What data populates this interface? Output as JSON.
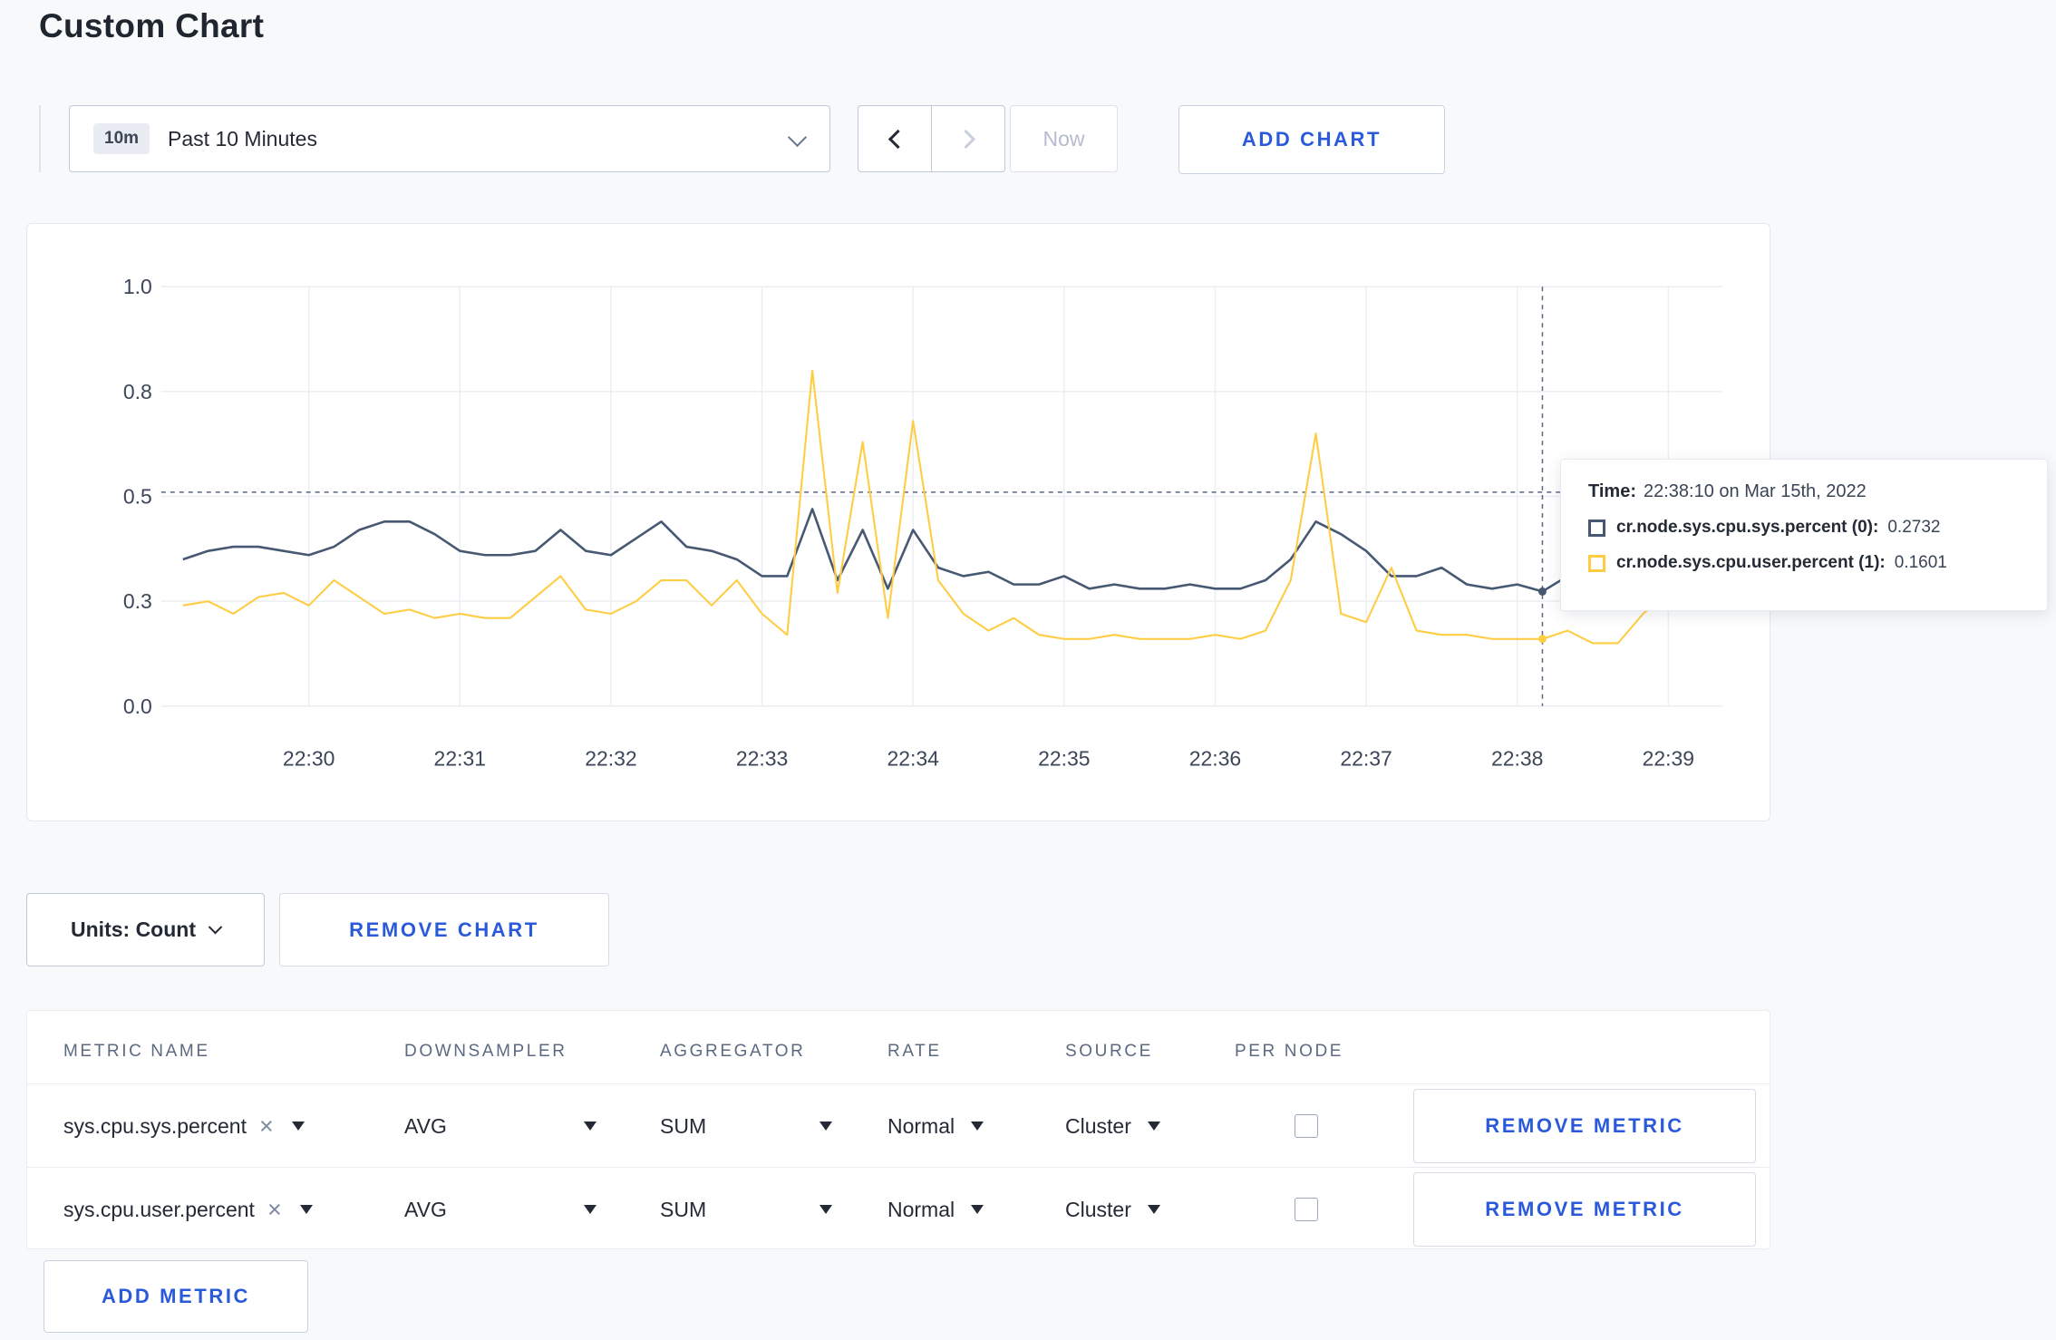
{
  "page": {
    "title": "Custom Chart"
  },
  "colors": {
    "accent_blue": "#2a5ada",
    "series_sys": "#475872",
    "series_user": "#ffcd44",
    "crosshair": "#5b6680"
  },
  "icons": {
    "clear": "×"
  },
  "toolbar": {
    "range_badge": "10m",
    "range_label": "Past 10 Minutes",
    "now_label": "Now",
    "add_chart_label": "ADD CHART"
  },
  "chart_data": {
    "type": "line",
    "title": "",
    "x_start_time": "22:29:10",
    "x_step_seconds": 10,
    "x_tick_labels": [
      "22:30",
      "22:31",
      "22:32",
      "22:33",
      "22:34",
      "22:35",
      "22:36",
      "22:37",
      "22:38",
      "22:39"
    ],
    "y_tick_labels": [
      "0.0",
      "0.3",
      "0.5",
      "0.8",
      "1.0"
    ],
    "y_tick_values": [
      0,
      0.25,
      0.5,
      0.75,
      1
    ],
    "ylim": [
      0,
      1
    ],
    "grid": true,
    "legend_position": "tooltip",
    "series": [
      {
        "name": "cr.node.sys.cpu.sys.percent",
        "color": "#475872",
        "values": [
          0.35,
          0.37,
          0.38,
          0.38,
          0.37,
          0.36,
          0.38,
          0.42,
          0.44,
          0.44,
          0.41,
          0.37,
          0.36,
          0.36,
          0.37,
          0.42,
          0.37,
          0.36,
          0.4,
          0.44,
          0.38,
          0.37,
          0.35,
          0.31,
          0.31,
          0.47,
          0.3,
          0.42,
          0.28,
          0.42,
          0.33,
          0.31,
          0.32,
          0.29,
          0.29,
          0.31,
          0.28,
          0.29,
          0.28,
          0.28,
          0.29,
          0.28,
          0.28,
          0.3,
          0.35,
          0.44,
          0.41,
          0.37,
          0.31,
          0.31,
          0.33,
          0.29,
          0.28,
          0.29,
          0.2732,
          0.31,
          0.29,
          0.3,
          0.31,
          0.3
        ]
      },
      {
        "name": "cr.node.sys.cpu.user.percent",
        "color": "#ffcd44",
        "values": [
          0.24,
          0.25,
          0.22,
          0.26,
          0.27,
          0.24,
          0.3,
          0.26,
          0.22,
          0.23,
          0.21,
          0.22,
          0.21,
          0.21,
          0.26,
          0.31,
          0.23,
          0.22,
          0.25,
          0.3,
          0.3,
          0.24,
          0.3,
          0.22,
          0.17,
          0.8,
          0.27,
          0.63,
          0.21,
          0.68,
          0.3,
          0.22,
          0.18,
          0.21,
          0.17,
          0.16,
          0.16,
          0.17,
          0.16,
          0.16,
          0.16,
          0.17,
          0.16,
          0.18,
          0.3,
          0.65,
          0.22,
          0.2,
          0.33,
          0.18,
          0.17,
          0.17,
          0.16,
          0.16,
          0.1601,
          0.18,
          0.15,
          0.15,
          0.22,
          0.27
        ]
      }
    ],
    "crosshair": {
      "x_index": 54,
      "y_value": 0.51,
      "dots": [
        {
          "value": 0.2732,
          "color": "#475872"
        },
        {
          "value": 0.1601,
          "color": "#ffcd44"
        }
      ]
    }
  },
  "tooltip": {
    "time_label": "Time:",
    "time_value": "22:38:10 on Mar 15th, 2022",
    "rows": [
      {
        "label": "cr.node.sys.cpu.sys.percent (0):",
        "value": "0.2732",
        "color": "#475872"
      },
      {
        "label": "cr.node.sys.cpu.user.percent (1):",
        "value": "0.1601",
        "color": "#ffcd44"
      }
    ]
  },
  "chart_controls": {
    "units_label": "Units: Count",
    "remove_chart_label": "REMOVE CHART"
  },
  "metrics_table": {
    "headers": [
      "METRIC NAME",
      "DOWNSAMPLER",
      "AGGREGATOR",
      "RATE",
      "SOURCE",
      "PER NODE"
    ],
    "rows": [
      {
        "metric": "sys.cpu.sys.percent",
        "downsampler": "AVG",
        "aggregator": "SUM",
        "rate": "Normal",
        "source": "Cluster",
        "per_node": false,
        "remove_label": "REMOVE METRIC"
      },
      {
        "metric": "sys.cpu.user.percent",
        "downsampler": "AVG",
        "aggregator": "SUM",
        "rate": "Normal",
        "source": "Cluster",
        "per_node": false,
        "remove_label": "REMOVE METRIC"
      }
    ],
    "add_metric_label": "ADD METRIC"
  }
}
